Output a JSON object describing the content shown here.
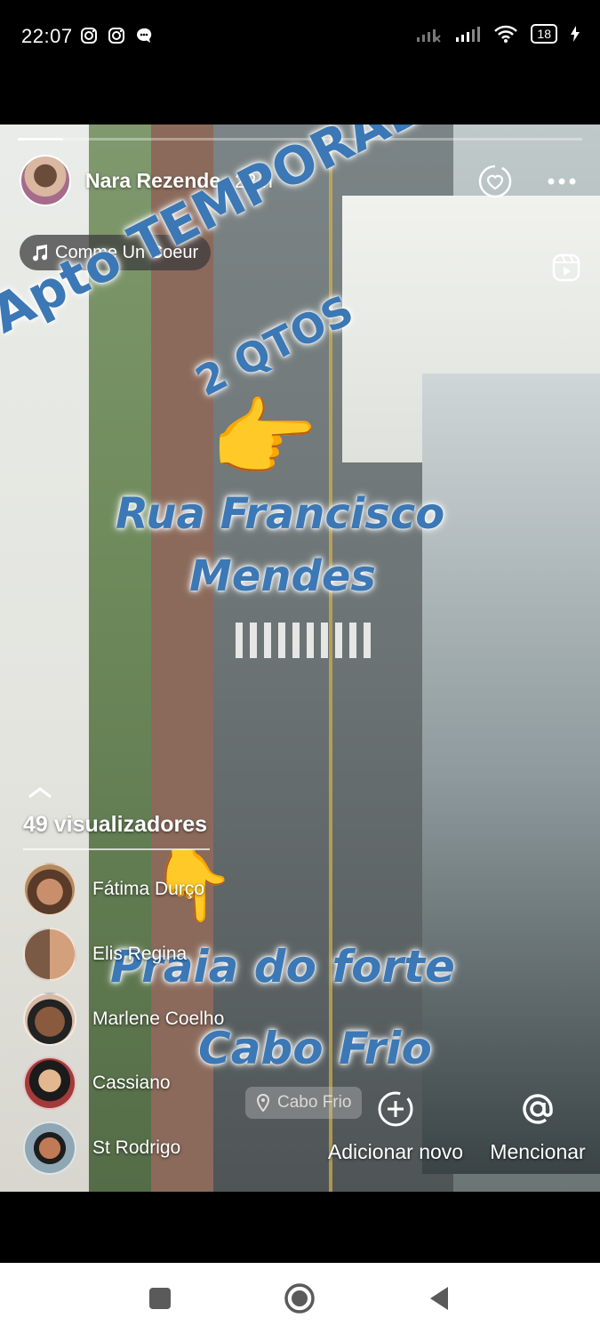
{
  "status_bar": {
    "time": "22:07",
    "battery": "18",
    "left_icons": [
      "instagram-icon",
      "instagram-icon",
      "chat-icon"
    ],
    "right_icons": [
      "signal-off-icon",
      "signal-icon",
      "wifi-icon",
      "battery-icon",
      "charging-icon"
    ]
  },
  "story": {
    "progress": 0.08,
    "user": {
      "name": "Nara Rezende",
      "time_ago": "22 h"
    },
    "music": {
      "title": "Comme Un Coeur"
    },
    "overlay_text": {
      "title_line1": "Apto TEMPORADA",
      "title_line2": "2 QTOS",
      "street_line1": "Rua Francisco",
      "street_line2": "Mendes",
      "beach_line1": "Praia do forte",
      "beach_line2": "Cabo Frio"
    },
    "location_sticker": "Cabo Frio",
    "viewers": {
      "count_label": "49 visualizadores",
      "list": [
        {
          "name": "Fátima Durço"
        },
        {
          "name": "Elis Regina"
        },
        {
          "name": "Marlene Coelho"
        },
        {
          "name": "Cassiano"
        },
        {
          "name": "St Rodrigo"
        }
      ]
    },
    "actions": {
      "add_new": "Adicionar novo",
      "mention": "Mencionar"
    }
  },
  "colors": {
    "overlay_text_blue": "#3b78b5",
    "background": "#000000",
    "navbar": "#ffffff"
  }
}
